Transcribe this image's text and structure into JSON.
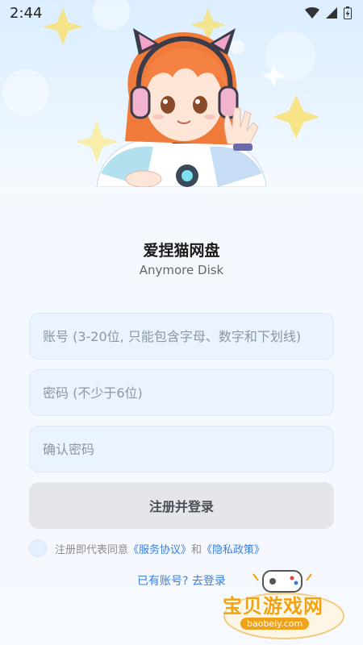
{
  "status_bar": {
    "time": "2:44"
  },
  "app": {
    "title": "爱捏猫网盘",
    "subtitle": "Anymore Disk"
  },
  "form": {
    "account_placeholder": "账号 (3-20位, 只能包含字母、数字和下划线)",
    "password_placeholder": "密码 (不少于6位)",
    "confirm_placeholder": "确认密码",
    "submit_label": "注册并登录"
  },
  "agreement": {
    "prefix": "注册即代表同意",
    "terms_link": "《服务协议》",
    "and": "和",
    "privacy_link": "《隐私政策》"
  },
  "login_link": "已有账号? 去登录",
  "watermark": {
    "text": "宝贝游戏网",
    "url": "baobeiy.com"
  },
  "icons": [
    "wifi-icon",
    "signal-icon",
    "battery-icon",
    "gamepad-icon"
  ],
  "colors": {
    "accent": "#3a7fe0",
    "button_bg": "#e4e6ea",
    "field_bg": "#eaf3ff",
    "watermark": "#f2a20c"
  }
}
